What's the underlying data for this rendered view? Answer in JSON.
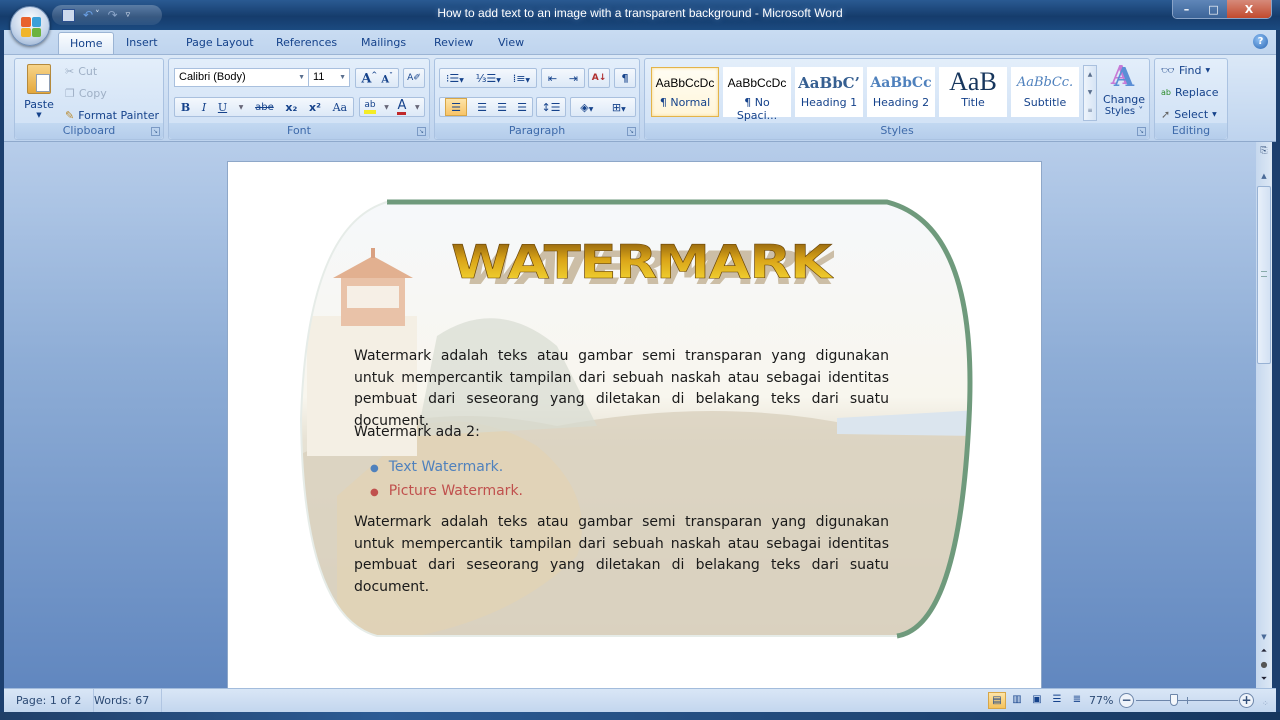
{
  "window": {
    "title": "How to add text to an image with a transparent background - Microsoft Word",
    "minimize": "–",
    "restore": "□",
    "close": "X"
  },
  "qat": {
    "save": "💾",
    "undo": "↶",
    "undo_more": "˅",
    "redo": "↷",
    "customize": "⩞"
  },
  "tabs": [
    {
      "label": "Home",
      "active": true
    },
    {
      "label": "Insert"
    },
    {
      "label": "Page Layout"
    },
    {
      "label": "References"
    },
    {
      "label": "Mailings"
    },
    {
      "label": "Review"
    },
    {
      "label": "View"
    }
  ],
  "help": "?",
  "clipboard": {
    "label": "Clipboard",
    "paste": "Paste",
    "cut": "Cut",
    "copy": "Copy",
    "format_painter": "Format Painter"
  },
  "font": {
    "label": "Font",
    "name": "Calibri (Body)",
    "size": "11",
    "grow": "A˄",
    "shrink": "A˅",
    "clear": "A⌀",
    "bold": "B",
    "italic": "I",
    "underline": "U",
    "strike": "abe",
    "subscript": "x₂",
    "superscript": "x²",
    "change_case": "Aa",
    "highlight": "ab",
    "font_color": "A",
    "highlight_color": "#f4ec26",
    "font_color_value": "#c0282a"
  },
  "paragraph": {
    "label": "Paragraph",
    "bullets": "•☰",
    "numbering": "1☰",
    "multilevel": "≡",
    "decrease_indent": "⇤",
    "increase_indent": "⇥",
    "sort": "A↓Z",
    "show_marks": "¶",
    "align_left": "≡",
    "center": "≡",
    "align_right": "≡",
    "justify": "≡",
    "line_spacing": "↕≡",
    "shading": "◇",
    "borders": "⊞"
  },
  "styles": {
    "label": "Styles",
    "items": [
      {
        "sample": "AaBbCcDc",
        "name": "¶ Normal",
        "selected": true
      },
      {
        "sample": "AaBbCcDc",
        "name": "¶ No Spaci..."
      },
      {
        "sample": "AaBbC’",
        "name": "Heading 1"
      },
      {
        "sample": "AaBbCc",
        "name": "Heading 2"
      },
      {
        "sample": "AaB",
        "name": "Title"
      },
      {
        "sample": "AaBbCc.",
        "name": "Subtitle"
      }
    ],
    "change_styles": "Change Styles",
    "change_styles_line1": "Change",
    "change_styles_line2": "Styles ˅"
  },
  "editing": {
    "label": "Editing",
    "find": "Find",
    "replace": "Replace",
    "select": "Select"
  },
  "document": {
    "wordart": "WATERMARK",
    "para1": "Watermark adalah teks atau gambar semi transparan yang digunakan untuk mempercantik tampilan dari sebuah naskah atau sebagai identitas pembuat dari seseorang yang diletakan di belakang teks dari suatu document.",
    "para2": "Watermark ada 2:",
    "bullets": [
      {
        "text": "Text Watermark.",
        "color": "#4f81bd"
      },
      {
        "text": "Picture Watermark.",
        "color": "#c0504d"
      }
    ],
    "para3": "Watermark adalah teks atau gambar semi transparan yang digunakan untuk mempercantik tampilan dari sebuah naskah atau sebagai identitas pembuat dari seseorang yang diletakan di belakang teks dari suatu document.",
    "shape_border_color": "#6f9a7c"
  },
  "status": {
    "page": "Page: 1 of 2",
    "words": "Words: 67",
    "zoom": "77%",
    "zoom_level_percent": 77
  },
  "colors": {
    "accent": "#15428b",
    "ribbon_bg": "#d3e3f6",
    "workspace": "#8eadd6"
  }
}
